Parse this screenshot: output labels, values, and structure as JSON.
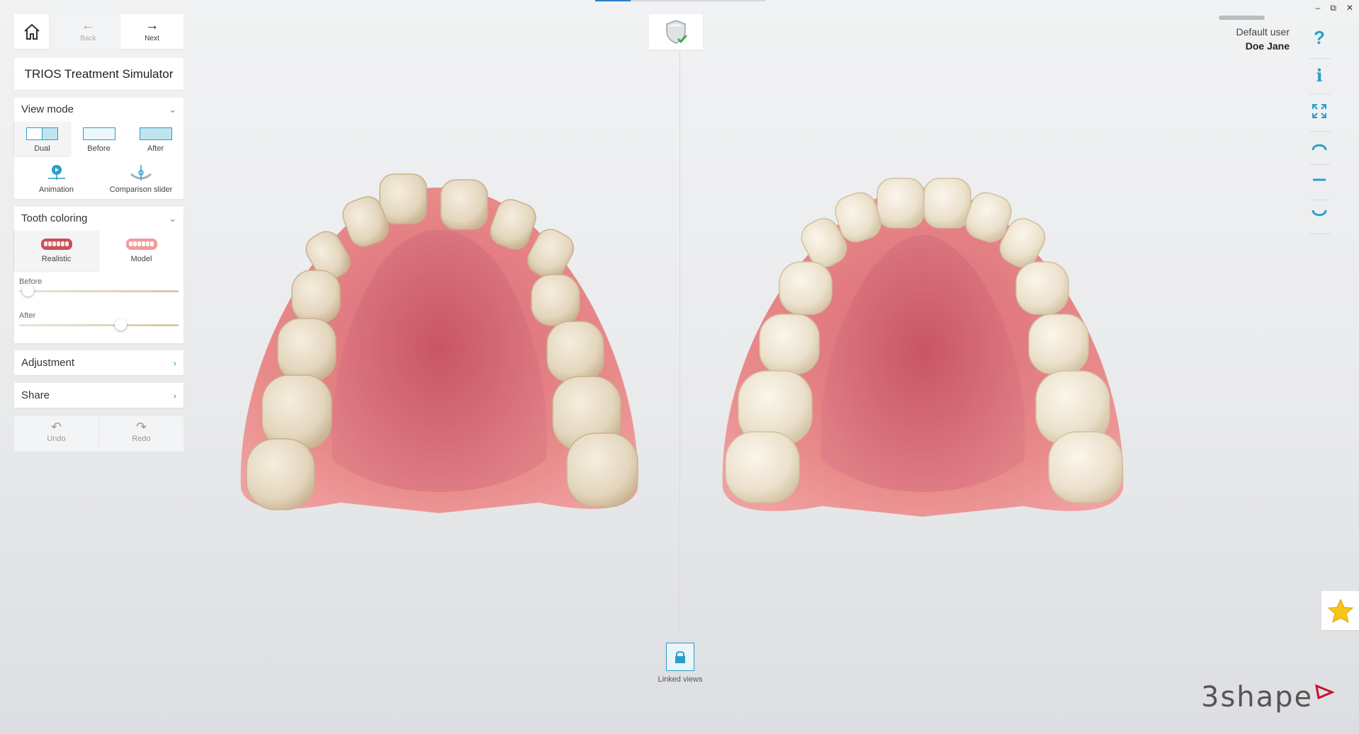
{
  "nav": {
    "back_label": "Back",
    "next_label": "Next"
  },
  "app_title": "TRIOS Treatment Simulator",
  "view_mode": {
    "header": "View mode",
    "options": [
      "Dual",
      "Before",
      "After"
    ],
    "selected": "Dual",
    "animation_label": "Animation",
    "comparison_label": "Comparison slider"
  },
  "tooth_coloring": {
    "header": "Tooth coloring",
    "options": [
      "Realistic",
      "Model"
    ],
    "selected": "Realistic",
    "before_label": "Before",
    "after_label": "After",
    "before_value": 0.02,
    "after_value": 0.65
  },
  "adjustment_label": "Adjustment",
  "share_label": "Share",
  "history": {
    "undo_label": "Undo",
    "redo_label": "Redo"
  },
  "user": {
    "role": "Default user",
    "name": "Doe Jane"
  },
  "linked_views_label": "Linked views",
  "brand": "3shape",
  "colors": {
    "accent": "#2a9fc9",
    "brand_red": "#c8102e",
    "gum": "#e98a8a",
    "tooth": "#eee3d0",
    "star": "#f5c518"
  },
  "icons": [
    "home-icon",
    "back-arrow-icon",
    "next-arrow-icon",
    "chevron-down-icon",
    "chevron-right-icon",
    "undo-icon",
    "redo-icon",
    "shield-check-icon",
    "help-icon",
    "info-icon",
    "expand-icon",
    "arch-upper-icon",
    "arch-flat-icon",
    "arch-lower-icon",
    "star-icon",
    "lock-icon",
    "minimize-icon",
    "restore-icon",
    "close-icon"
  ]
}
